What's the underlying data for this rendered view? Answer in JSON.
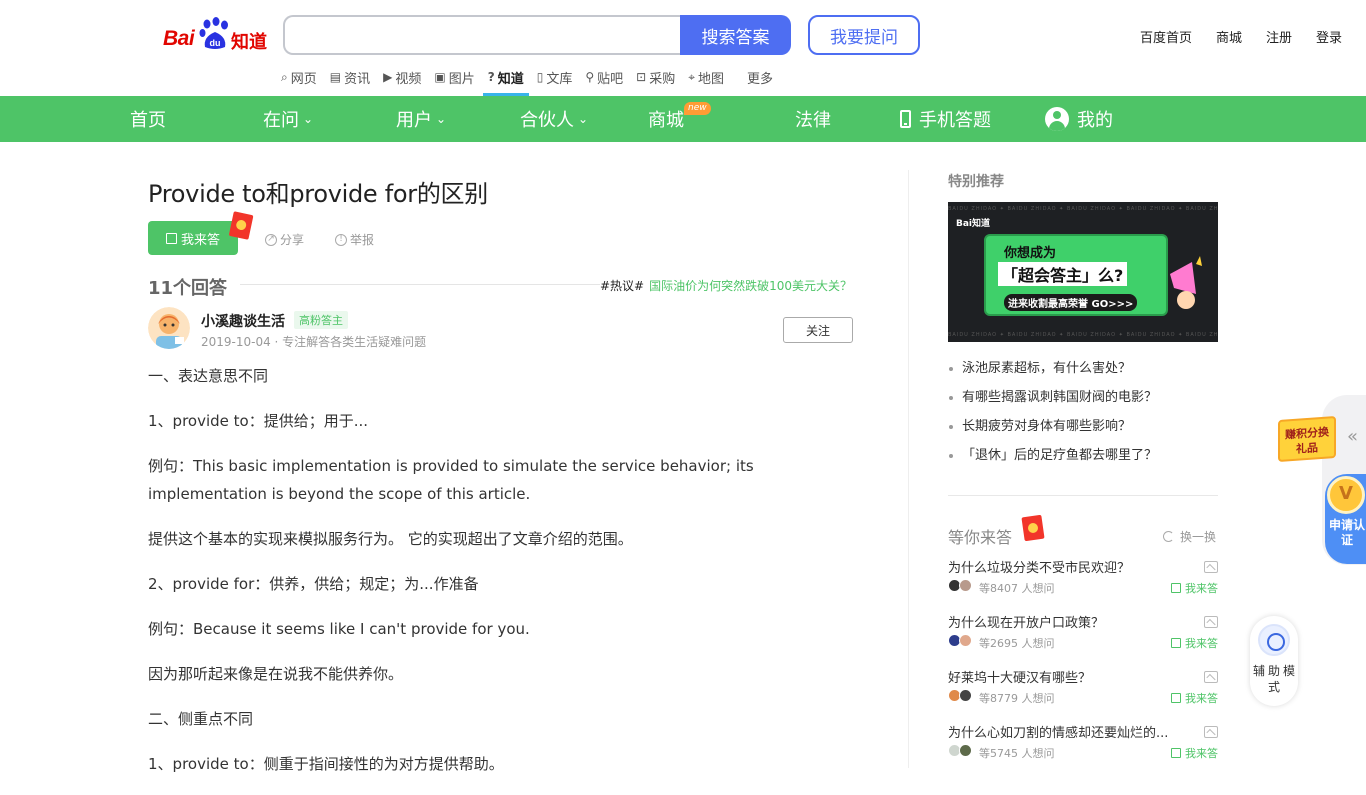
{
  "header": {
    "logo_bai": "Bai",
    "logo_zhidao": "知道",
    "search_value": "",
    "search_button": "搜索答案",
    "ask_button": "我要提问",
    "top_links": [
      "百度首页",
      "商城",
      "注册",
      "登录"
    ]
  },
  "subnav": {
    "items": [
      {
        "label": "网页",
        "icon": "search-icon",
        "glyph": "⌕"
      },
      {
        "label": "资讯",
        "icon": "news-icon",
        "glyph": "▤"
      },
      {
        "label": "视频",
        "icon": "video-icon",
        "glyph": "▶"
      },
      {
        "label": "图片",
        "icon": "image-icon",
        "glyph": "▣"
      },
      {
        "label": "知道",
        "icon": "question-icon",
        "glyph": "?",
        "active": true
      },
      {
        "label": "文库",
        "icon": "doc-icon",
        "glyph": "▯"
      },
      {
        "label": "贴吧",
        "icon": "tieba-icon",
        "glyph": "⚲"
      },
      {
        "label": "采购",
        "icon": "bag-icon",
        "glyph": "⊡"
      },
      {
        "label": "地图",
        "icon": "map-icon",
        "glyph": "⌖"
      }
    ],
    "more": "更多"
  },
  "greennav": {
    "home": "首页",
    "asking": "在问",
    "users": "用户",
    "partners": "合伙人",
    "mall": "商城",
    "mall_badge": "new",
    "law": "法律",
    "mobile": "手机答题",
    "mine": "我的"
  },
  "question": {
    "title": "Provide to和provide for的区别",
    "answer_button": "我来答",
    "share": "分享",
    "report": "举报"
  },
  "answers": {
    "count_label": "11个回答",
    "hot_tag": "#热议#",
    "hot_link": "国际油价为何突然跌破100美元大关？"
  },
  "author": {
    "name": "小溪趣谈生活",
    "badge": "高粉答主",
    "meta": "2019-10-04 · 专注解答各类生活疑难问题",
    "follow": "关注"
  },
  "answer_paragraphs": [
    "一、表达意思不同",
    "1、provide to：提供给；用于...",
    "例句：This basic implementation is provided to simulate the service behavior; its implementation is beyond the scope of this article.",
    "提供这个基本的实现来模拟服务行为。 它的实现超出了文章介绍的范围。",
    "2、provide for：供养，供给；规定；为...作准备",
    "例句：Because it seems like I can't provide for you.",
    "因为那听起来像是在说我不能供养你。",
    "二、侧重点不同",
    "1、provide to：侧重于指间接性的为对方提供帮助。"
  ],
  "sidebar": {
    "special_title": "特别推荐",
    "banner": {
      "logo": "Bai知道",
      "line1": "你想成为",
      "line2": "「超会答主」么?",
      "line3": "进来收割最高荣誉 GO>>>",
      "strip_text": "BAIDU ZHIDAO  ✦  BAIDU ZHIDAO  ✦  BAIDU ZHIDAO  ✦  BAIDU ZHIDAO  ✦  BAIDU ZHIDAO"
    },
    "recommendations": [
      "泳池尿素超标，有什么害处？",
      "有哪些揭露讽刺韩国财阀的电影？",
      "长期疲劳对身体有哪些影响？",
      "「退休」后的足疗鱼都去哪里了？"
    ],
    "wait_title": "等你来答",
    "refresh": "换一换",
    "waiting_questions": [
      {
        "title": "为什么垃圾分类不受市民欢迎？",
        "count": "等8407 人想问",
        "answer": "我来答"
      },
      {
        "title": "为什么现在开放户口政策？",
        "count": "等2695 人想问",
        "answer": "我来答"
      },
      {
        "title": "好莱坞十大硬汉有哪些？",
        "count": "等8779 人想问",
        "answer": "我来答"
      },
      {
        "title": "为什么心如刀割的情感却还要灿烂的...",
        "count": "等5745 人想问",
        "answer": "我来答"
      }
    ]
  },
  "floating": {
    "earn_points": "赚积分换礼品",
    "apply_cert": "申请认证",
    "assist_mode": "辅助模式",
    "arrows": "«"
  },
  "colors": {
    "brand_green": "#4ec467",
    "brand_blue": "#4e6ef2",
    "logo_red": "#e10601"
  }
}
